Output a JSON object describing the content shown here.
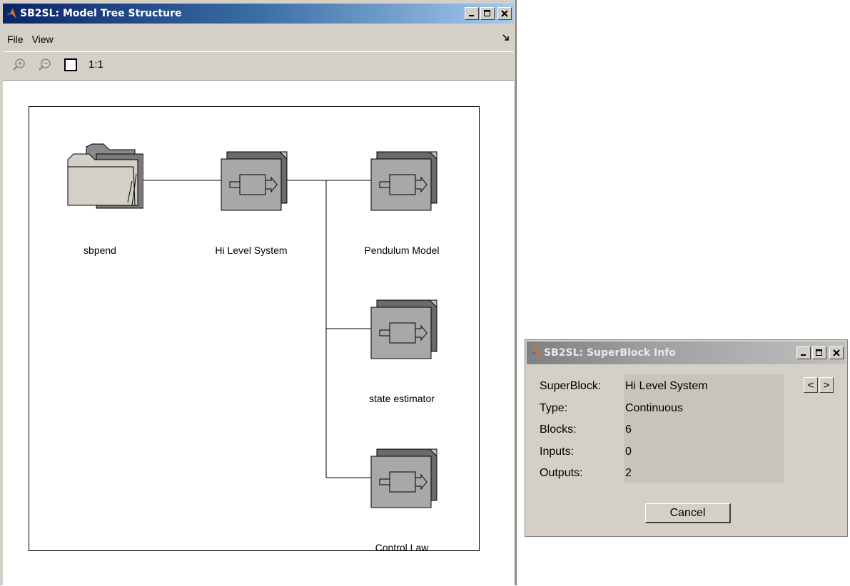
{
  "main_window": {
    "title": "SB2SL: Model Tree Structure",
    "menu": [
      "File",
      "View"
    ],
    "toolbar": {
      "zoom_in_icon": "zoom-in-icon",
      "zoom_out_icon": "zoom-out-icon",
      "fit_icon": "square-icon",
      "zoom_label": "1:1"
    },
    "tree": {
      "nodes": [
        {
          "id": "sbpend",
          "label": "sbpend",
          "icon": "folder-icon"
        },
        {
          "id": "hi-level-system",
          "label": "Hi Level System",
          "icon": "superblock-icon"
        },
        {
          "id": "pendulum-model",
          "label": "Pendulum Model",
          "icon": "superblock-icon"
        },
        {
          "id": "state-estimator",
          "label": "state estimator",
          "icon": "superblock-icon"
        },
        {
          "id": "control-law",
          "label": "Control Law",
          "icon": "superblock-icon"
        }
      ]
    }
  },
  "info_dialog": {
    "title": "SB2SL: SuperBlock Info",
    "fields": [
      {
        "label": "SuperBlock:",
        "value": "Hi Level System"
      },
      {
        "label": "Type:",
        "value": "Continuous"
      },
      {
        "label": "Blocks:",
        "value": "6"
      },
      {
        "label": "Inputs:",
        "value": "0"
      },
      {
        "label": "Outputs:",
        "value": "2"
      }
    ],
    "prev_label": "<",
    "next_label": ">",
    "cancel_label": "Cancel"
  }
}
